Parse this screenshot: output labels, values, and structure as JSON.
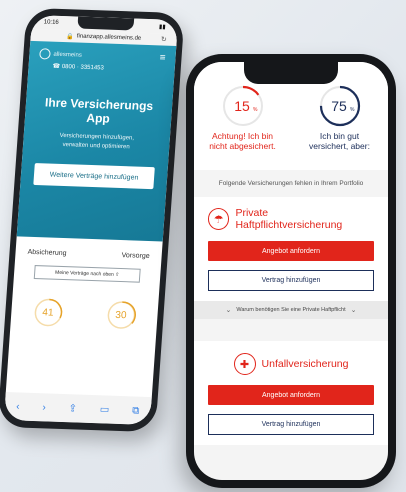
{
  "back_phone": {
    "status_time": "10:16",
    "url": "finanzapp.allesmeins.de",
    "logo_text": "allesmeins",
    "phone_number": "0800 · 3351453",
    "hero_title": "Ihre Versicherungs App",
    "hero_subtitle_line1": "Versicherungen hinzufügen,",
    "hero_subtitle_line2": "verwalten und optimieren",
    "cta_label": "Weitere Verträge hinzufügen",
    "tabs": [
      "Absicherung",
      "Vorsorge"
    ],
    "more_contracts_label": "Meine Verträge nach oben",
    "gauges": [
      {
        "value": "41",
        "unit": "%"
      },
      {
        "value": "30",
        "unit": "%"
      }
    ]
  },
  "front_phone": {
    "gauges": [
      {
        "value": "15",
        "unit": "%",
        "label_line1": "Achtung! Ich bin",
        "label_line2": "nicht abgesichert.",
        "fraction": 0.15,
        "color": "#e1251b"
      },
      {
        "value": "75",
        "unit": "%",
        "label_line1": "Ich bin gut",
        "label_line2": "versichert, aber:",
        "fraction": 0.75,
        "color": "#1d2f5a"
      }
    ],
    "missing_text": "Folgende Versicherungen fehlen in Ihrem Portfolio",
    "cards": [
      {
        "title": "Private Haftpflichtversicherung",
        "offer_label": "Angebot anfordern",
        "add_label": "Vertrag hinzufügen"
      },
      {
        "title": "Unfallversicherung",
        "offer_label": "Angebot anfordern",
        "add_label": "Vertrag hinzufügen"
      }
    ],
    "why_text": "Warum benötigen Sie eine Private Haftpflicht"
  },
  "colors": {
    "accent_red": "#e1251b",
    "navy": "#1d2f5a",
    "teal": "#1b87a6",
    "orange": "#e6a32a"
  }
}
